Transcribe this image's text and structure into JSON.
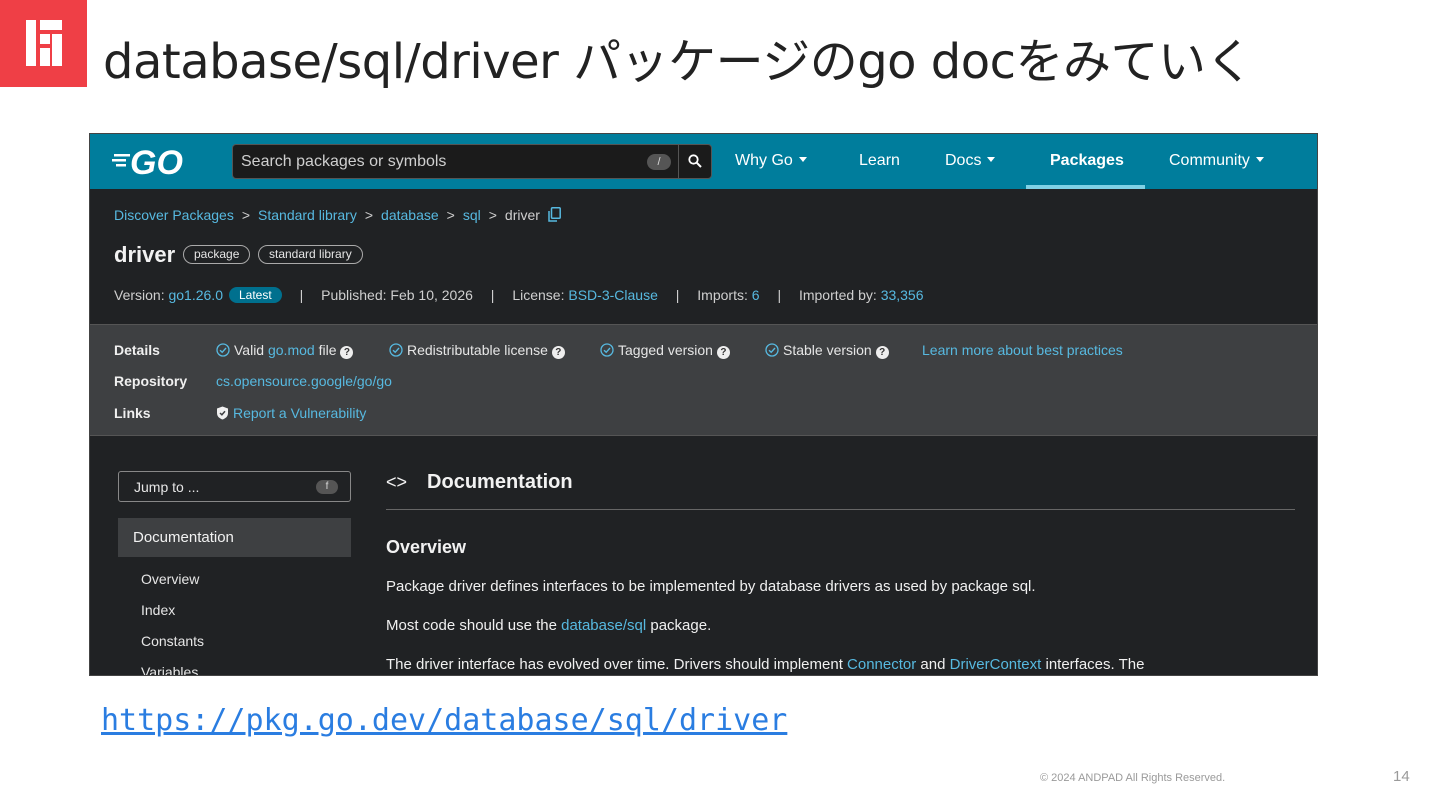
{
  "slide": {
    "title": "database/sql/driver パッケージのgo docをみていく",
    "url": "https://pkg.go.dev/database/sql/driver",
    "copyright": "© 2024 ANDPAD All Rights Reserved.",
    "page_number": "14",
    "brand_color": "#ef3f46"
  },
  "header": {
    "search_placeholder": "Search packages or symbols",
    "search_shortcut": "/",
    "nav": {
      "why_go": "Why Go",
      "learn": "Learn",
      "docs": "Docs",
      "packages": "Packages",
      "community": "Community"
    },
    "header_color": "#007d9c"
  },
  "breadcrumb": {
    "discover": "Discover Packages",
    "standard_library": "Standard library",
    "database": "database",
    "sql": "sql",
    "driver": "driver",
    "separator": ">"
  },
  "package": {
    "name": "driver",
    "badge_package": "package",
    "badge_stdlib": "standard library",
    "version_label": "Version:",
    "version": "go1.26.0",
    "latest": "Latest",
    "published_label": "Published:",
    "published": "Feb 10, 2026",
    "license_label": "License:",
    "license": "BSD-3-Clause",
    "imports_label": "Imports:",
    "imports": "6",
    "imported_by_label": "Imported by:",
    "imported_by": "33,356",
    "bar": "|"
  },
  "details": {
    "details_label": "Details",
    "valid": "Valid",
    "gomod": "go.mod",
    "file": "file",
    "redistributable": "Redistributable license",
    "tagged": "Tagged version",
    "stable": "Stable version",
    "best_practices": "Learn more about best practices",
    "repository_label": "Repository",
    "repository": "cs.opensource.google/go/go",
    "links_label": "Links",
    "report": "Report a Vulnerability"
  },
  "sidebar": {
    "jump_to": "Jump to ...",
    "jump_shortcut": "f",
    "documentation": "Documentation",
    "items": [
      "Overview",
      "Index",
      "Constants",
      "Variables"
    ]
  },
  "doc": {
    "angles": "<>",
    "heading": "Documentation",
    "overview": "Overview",
    "p1": "Package driver defines interfaces to be implemented by database drivers as used by package sql.",
    "p2_pre": "Most code should use the ",
    "p2_link": "database/sql",
    "p2_post": " package.",
    "p3_pre": "The driver interface has evolved over time. Drivers should implement ",
    "p3_link1": "Connector",
    "p3_mid": " and ",
    "p3_link2": "DriverContext",
    "p3_post": " interfaces. The"
  }
}
